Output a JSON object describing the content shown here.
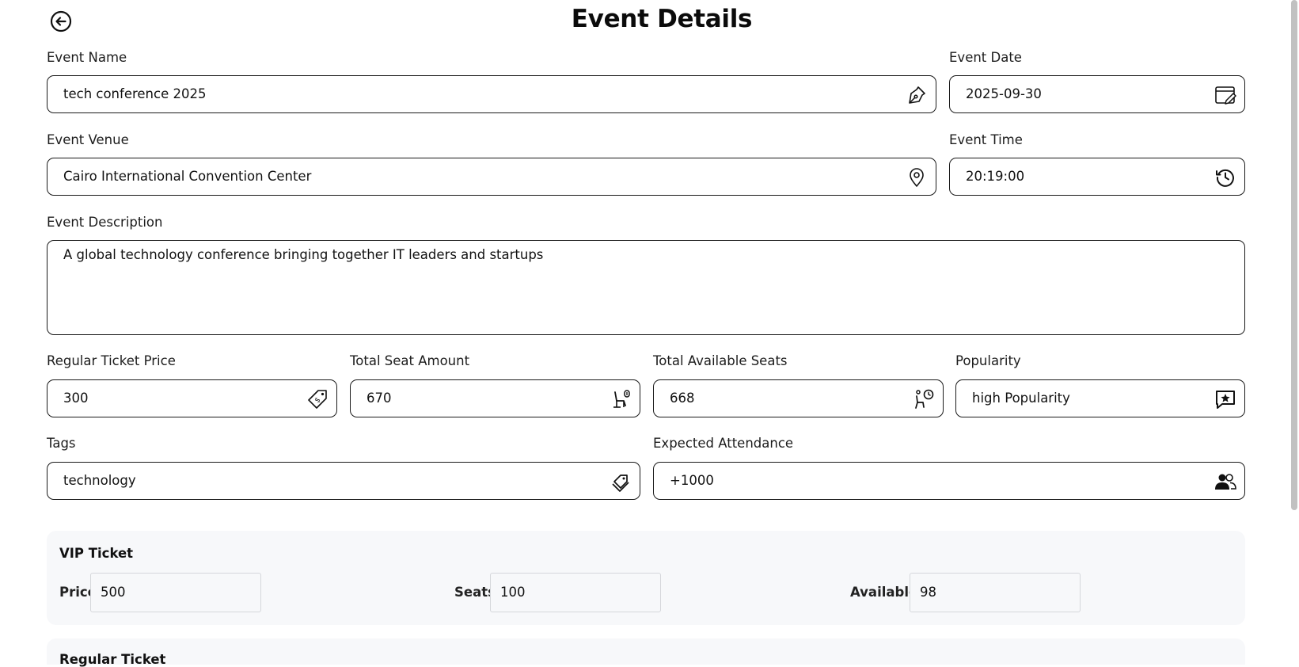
{
  "header": {
    "title": "Event Details",
    "back_icon": "arrow-left-circle-icon"
  },
  "fields": {
    "event_name": {
      "label": "Event Name",
      "value": "tech conference 2025",
      "icon": "pen-nib-icon"
    },
    "event_date": {
      "label": "Event Date",
      "value": "2025-09-30",
      "icon": "calendar-edit-icon"
    },
    "event_venue": {
      "label": "Event Venue",
      "value": "Cairo International Convention Center",
      "icon": "map-pin-icon"
    },
    "event_time": {
      "label": "Event Time",
      "value": "20:19:00",
      "icon": "clock-history-icon"
    },
    "event_description": {
      "label": "Event Description",
      "value": "A global technology conference bringing together IT leaders and startups"
    },
    "regular_ticket_price": {
      "label": "Regular Ticket Price",
      "value": "300",
      "icon": "price-tag-icon"
    },
    "total_seat_amount": {
      "label": "Total Seat Amount",
      "value": "670",
      "icon": "seat-icon"
    },
    "total_available_seats": {
      "label": "Total Available Seats",
      "value": "668",
      "icon": "seat-clock-icon"
    },
    "popularity": {
      "label": "Popularity",
      "value": "high Popularity",
      "icon": "star-message-icon"
    },
    "tags": {
      "label": "Tags",
      "value": "technology",
      "icon": "tags-icon"
    },
    "expected_attendance": {
      "label": "Expected Attendance",
      "value": "+1000",
      "icon": "people-icon"
    }
  },
  "vip_ticket": {
    "title": "VIP Ticket",
    "price_label": "Price",
    "price": "500",
    "seats_label": "Seats",
    "seats": "100",
    "available_label": "Available",
    "available": "98"
  },
  "regular_ticket": {
    "title": "Regular Ticket"
  }
}
